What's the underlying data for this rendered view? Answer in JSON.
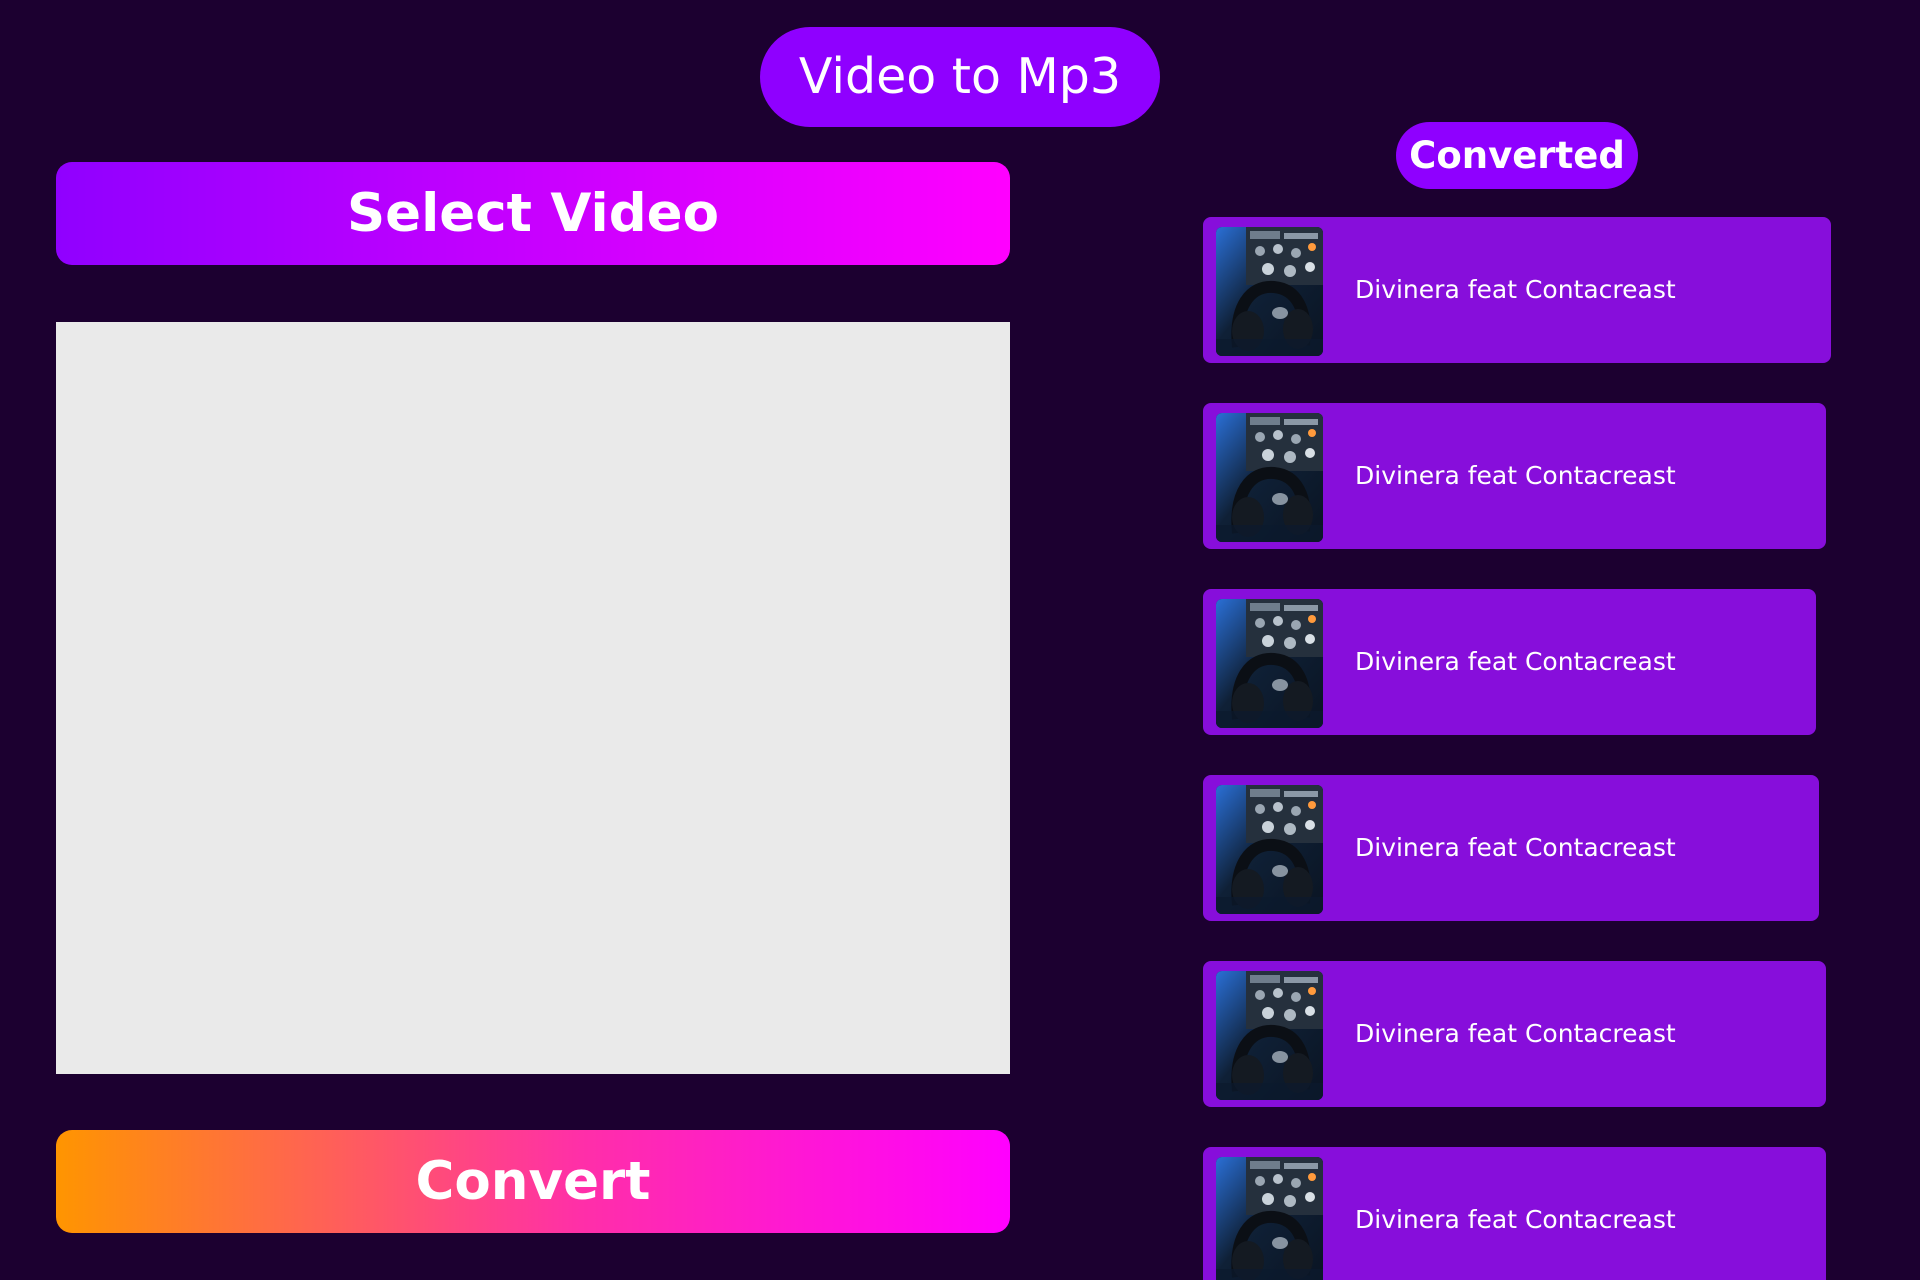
{
  "app": {
    "title": "Video to Mp3"
  },
  "left_panel": {
    "select_label": "Select Video",
    "convert_label": "Convert"
  },
  "converted": {
    "heading": "Converted",
    "items": [
      {
        "label": "Divinera feat Contacreast",
        "thumbnail": "headphones-mixer-image"
      },
      {
        "label": "Divinera feat Contacreast",
        "thumbnail": "headphones-mixer-image"
      },
      {
        "label": "Divinera feat Contacreast",
        "thumbnail": "headphones-mixer-image"
      },
      {
        "label": "Divinera feat Contacreast",
        "thumbnail": "headphones-mixer-image"
      },
      {
        "label": "Divinera feat Contacreast",
        "thumbnail": "headphones-mixer-image"
      },
      {
        "label": "Divinera feat Contacreast",
        "thumbnail": "headphones-mixer-image"
      }
    ]
  },
  "colors": {
    "background": "#1c0030",
    "accent": "#8f00ff",
    "list_item": "#870edb",
    "preview_area": "#eaeaea"
  }
}
